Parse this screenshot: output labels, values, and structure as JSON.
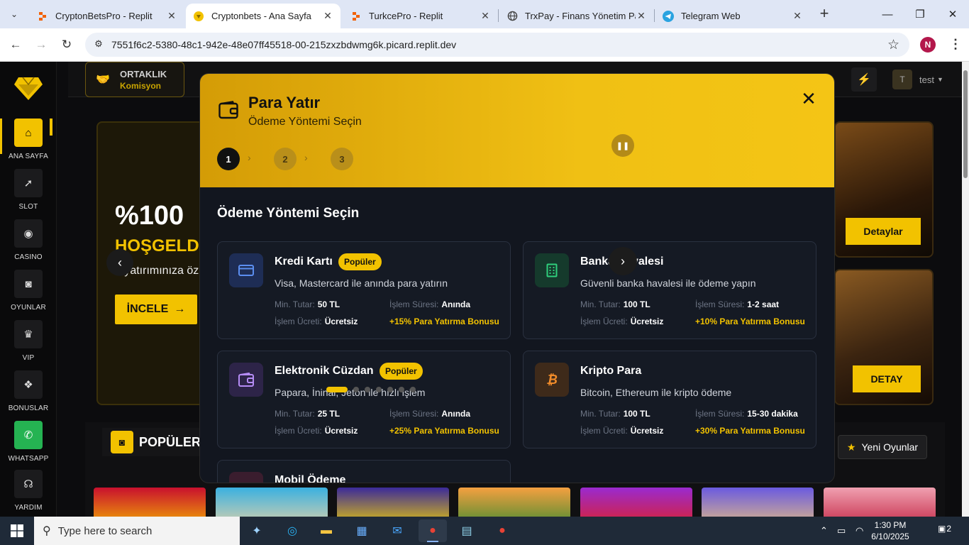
{
  "browser": {
    "tabs": [
      {
        "title": "CryptonBetsPro - Replit",
        "favicon": "replit-icon",
        "active": false
      },
      {
        "title": "Cryptonbets - Ana Sayfa",
        "favicon": "site-icon",
        "active": true
      },
      {
        "title": "TurkcePro - Replit",
        "favicon": "replit-icon",
        "active": false
      },
      {
        "title": "TrxPay - Finans Yönetim Pane",
        "favicon": "globe-icon",
        "active": false
      },
      {
        "title": "Telegram Web",
        "favicon": "telegram-icon",
        "active": false
      }
    ],
    "url": "7551f6c2-5380-48c1-942e-48e07ff45518-00-215zxzbdwmg6k.picard.replit.dev",
    "profile_initial": "N"
  },
  "site": {
    "sidebar": [
      {
        "label": "ANA SAYFA",
        "icon": "home-icon"
      },
      {
        "label": "SLOT",
        "icon": "rocket-icon"
      },
      {
        "label": "CASINO",
        "icon": "chips-icon"
      },
      {
        "label": "OYUNLAR",
        "icon": "gamepad-icon"
      },
      {
        "label": "VIP",
        "icon": "crown-icon"
      },
      {
        "label": "BONUSLAR",
        "icon": "gift-icon"
      },
      {
        "label": "WHATSAPP",
        "icon": "whatsapp-icon"
      },
      {
        "label": "YARDIM",
        "icon": "headset-icon"
      }
    ],
    "topnav": {
      "ortaklik_title": "ORTAKLIK",
      "ortaklik_sub": "Komisyon",
      "user_initial": "T",
      "user_name": "test"
    },
    "hero": {
      "percent": "%100",
      "headline": "HOŞGELD",
      "subtitle": "...yatırımınıza öz",
      "button": "İNCELE"
    },
    "side_banners": [
      {
        "button": "Detaylar"
      },
      {
        "button": "DETAY"
      }
    ],
    "slots": {
      "title": "POPÜLER SLOT OYUNLARI",
      "new_games": "Yeni Oyunlar"
    }
  },
  "modal": {
    "title": "Para Yatır",
    "subtitle": "Ödeme Yöntemi Seçin",
    "steps": [
      "1",
      "2",
      "3"
    ],
    "current_step": 1,
    "section_title": "Ödeme Yöntemi Seçin",
    "labels": {
      "min": "Min. Tutar:",
      "duration": "İşlem Süresi:",
      "fee": "İşlem Ücreti:"
    },
    "methods": [
      {
        "name": "Kredi Kartı",
        "badge": "Popüler",
        "desc": "Visa, Mastercard ile anında para yatırın",
        "min": "50 TL",
        "duration": "Anında",
        "fee": "Ücretsiz",
        "bonus": "+15% Para Yatırma Bonusu",
        "icon": "credit-card-icon"
      },
      {
        "name": "Banka Havalesi",
        "badge": "",
        "desc": "Güvenli banka havalesi ile ödeme yapın",
        "min": "100 TL",
        "duration": "1-2 saat",
        "fee": "Ücretsiz",
        "bonus": "+10% Para Yatırma Bonusu",
        "icon": "bank-icon"
      },
      {
        "name": "Elektronik Cüzdan",
        "badge": "Popüler",
        "desc": "Papara, İninal, Jeton ile hızlı işlem",
        "min": "25 TL",
        "duration": "Anında",
        "fee": "Ücretsiz",
        "bonus": "+25% Para Yatırma Bonusu",
        "icon": "wallet-icon"
      },
      {
        "name": "Kripto Para",
        "badge": "",
        "desc": "Bitcoin, Ethereum ile kripto ödeme",
        "min": "100 TL",
        "duration": "15-30 dakika",
        "fee": "Ücretsiz",
        "bonus": "+30% Para Yatırma Bonusu",
        "icon": "bitcoin-icon"
      },
      {
        "name": "Mobil Ödeme",
        "icon": "mobile-icon"
      }
    ]
  },
  "taskbar": {
    "search_placeholder": "Type here to search",
    "time": "1:30 PM",
    "date": "6/10/2025",
    "notifications": "2"
  },
  "colors": {
    "accent": "#f2c200",
    "modal_bg": "#12161f",
    "whatsapp": "#25b352"
  }
}
